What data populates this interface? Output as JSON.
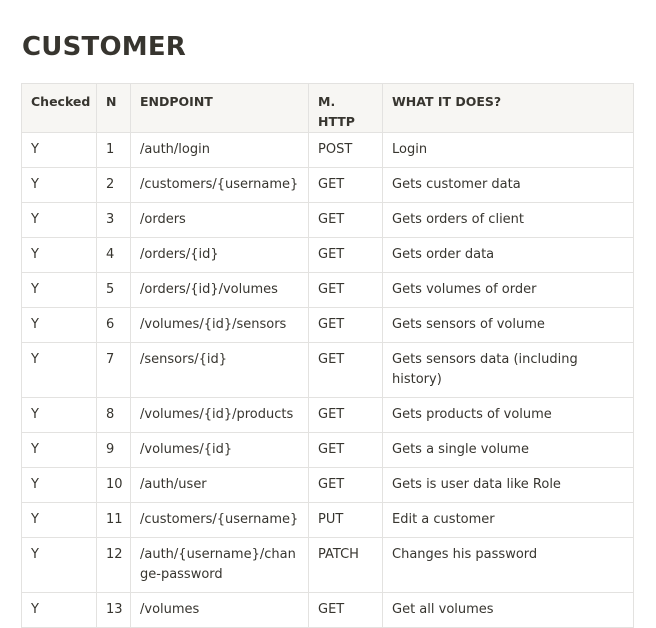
{
  "title": "CUSTOMER",
  "table": {
    "headers": [
      "Checked",
      "N",
      "ENDPOINT",
      "M. HTTP",
      "WHAT IT DOES?"
    ],
    "rows": [
      {
        "checked": "Y",
        "n": "1",
        "endpoint": "/auth/login",
        "method": "POST",
        "what": "Login"
      },
      {
        "checked": "Y",
        "n": "2",
        "endpoint": "/customers/{username}",
        "method": "GET",
        "what": "Gets customer data"
      },
      {
        "checked": "Y",
        "n": "3",
        "endpoint": "/orders",
        "method": "GET",
        "what": "Gets orders of client"
      },
      {
        "checked": "Y",
        "n": "4",
        "endpoint": "/orders/{id}",
        "method": "GET",
        "what": "Gets order data"
      },
      {
        "checked": "Y",
        "n": "5",
        "endpoint": "/orders/{id}/volumes",
        "method": "GET",
        "what": "Gets volumes of order"
      },
      {
        "checked": "Y",
        "n": "6",
        "endpoint": "/volumes/{id}/sensors",
        "method": "GET",
        "what": "Gets sensors of volume"
      },
      {
        "checked": "Y",
        "n": "7",
        "endpoint": "/sensors/{id}",
        "method": "GET",
        "what": "Gets sensors data (including history)"
      },
      {
        "checked": "Y",
        "n": "8",
        "endpoint": "/volumes/{id}/products",
        "method": "GET",
        "what": "Gets products of volume"
      },
      {
        "checked": "Y",
        "n": "9",
        "endpoint": "/volumes/{id}",
        "method": "GET",
        "what": "Gets a single volume"
      },
      {
        "checked": "Y",
        "n": "10",
        "endpoint": "/auth/user",
        "method": "GET",
        "what": "Gets is user data like Role"
      },
      {
        "checked": "Y",
        "n": "11",
        "endpoint": "/customers/{username}",
        "method": "PUT",
        "what": "Edit a customer"
      },
      {
        "checked": "Y",
        "n": "12",
        "endpoint": "/auth/{username}/change-password",
        "method": "PATCH",
        "what": "Changes his password"
      },
      {
        "checked": "Y",
        "n": "13",
        "endpoint": "/volumes",
        "method": "GET",
        "what": "Get all volumes"
      }
    ]
  }
}
